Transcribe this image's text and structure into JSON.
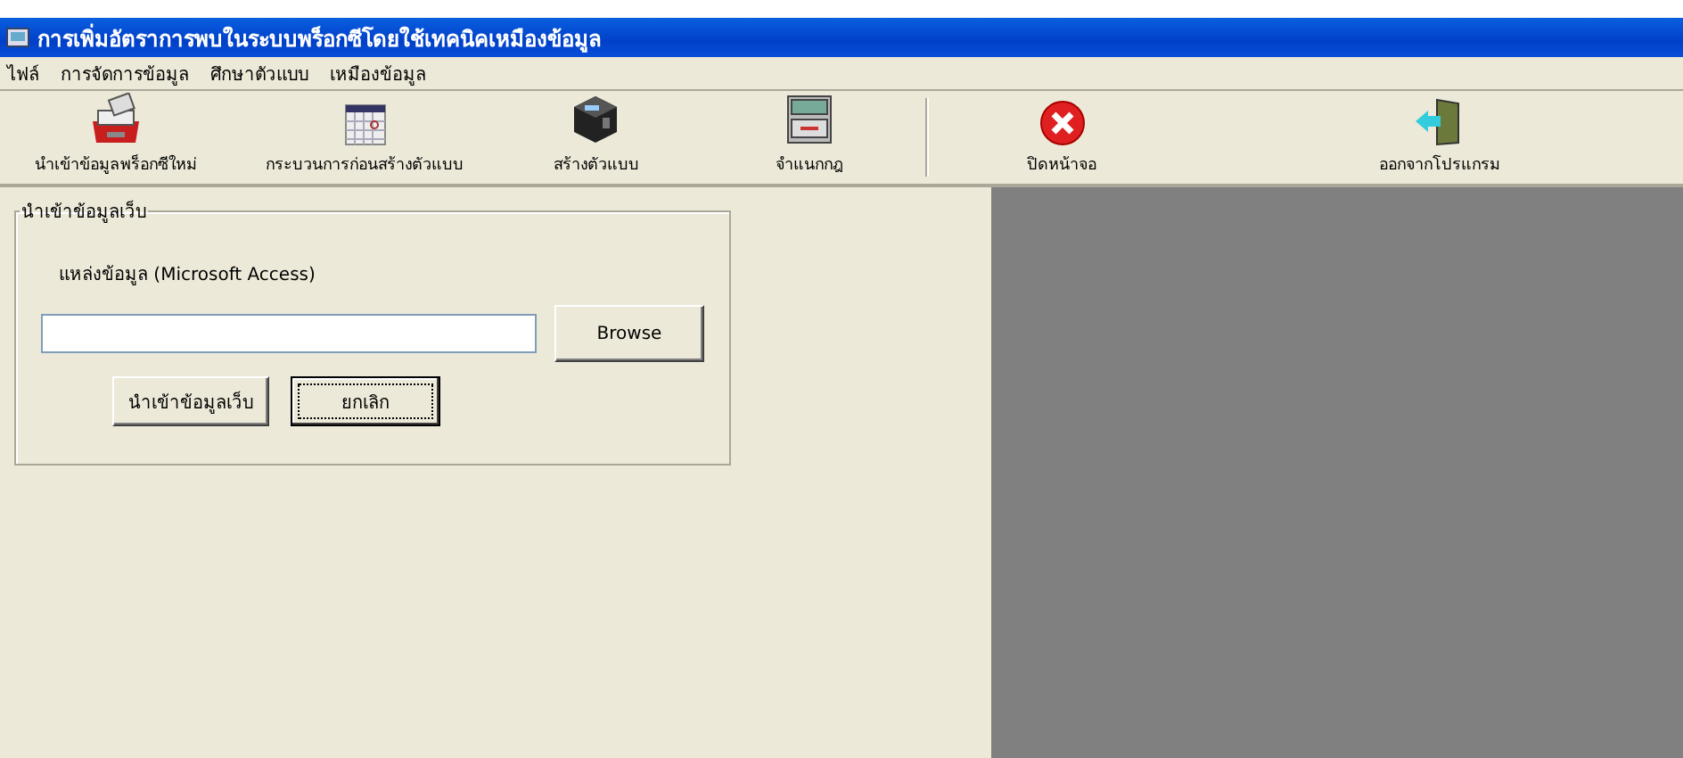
{
  "window": {
    "title": "การเพิ่มอัตราการพบในระบบพร็อกซีโดยใช้เทคนิคเหมืองข้อมูล"
  },
  "menu": [
    "ไฟล์",
    "การจัดการข้อมูล",
    "ศึกษาตัวแบบ",
    "เหมืองข้อมูล"
  ],
  "toolbar": [
    {
      "kind": "cardfile",
      "label": "นำเข้าข้อมูลพร็อกซีใหม่"
    },
    {
      "kind": "calendar",
      "label": "กระบวนการก่อนสร้างตัวแบบ"
    },
    {
      "kind": "cube",
      "label": "สร้างตัวแบบ"
    },
    {
      "kind": "cabinet",
      "label": "จำแนกกฎ"
    },
    {
      "kind": "close",
      "label": "ปิดหน้าจอ"
    },
    {
      "kind": "exit",
      "label": "ออกจากโปรแกรม"
    }
  ],
  "import_group": {
    "title": "นำเข้าข้อมูลเว็บ",
    "source_label": "แหล่งข้อมูล (Microsoft Access)",
    "browse": "Browse",
    "buttons": [
      {
        "label": "นำเข้าข้อมูลเว็บ",
        "focused": false
      },
      {
        "label": "ยกเลิก",
        "focused": true
      }
    ]
  }
}
